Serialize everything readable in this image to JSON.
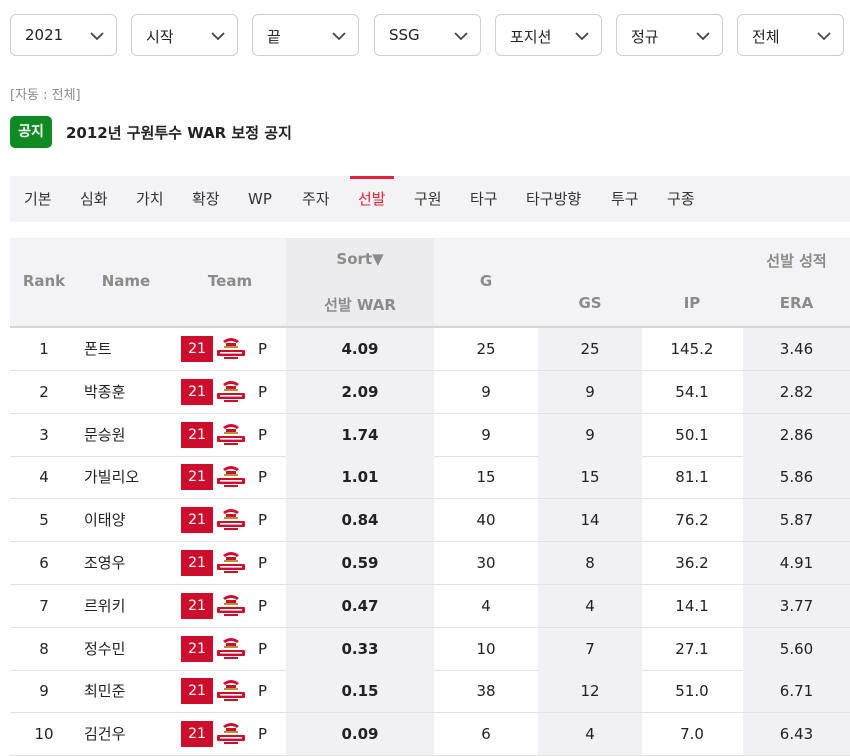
{
  "filters": [
    {
      "label": "2021"
    },
    {
      "label": "시작"
    },
    {
      "label": "끝"
    },
    {
      "label": "SSG"
    },
    {
      "label": "포지션"
    },
    {
      "label": "정규"
    },
    {
      "label": "전체"
    }
  ],
  "auto_note": "[자동 : 전체]",
  "notice": {
    "badge": "공지",
    "text": "2012년 구원투수 WAR 보정 공지"
  },
  "tabs": [
    "기본",
    "심화",
    "가치",
    "확장",
    "WP",
    "주자",
    "선발",
    "구원",
    "타구",
    "타구방향",
    "투구",
    "구종"
  ],
  "active_tab": "선발",
  "table": {
    "headers": {
      "rank": "Rank",
      "name": "Name",
      "team": "Team",
      "sort": "Sort▼",
      "war": "선발 WAR",
      "g": "G",
      "group": "선발 성적",
      "gs": "GS",
      "ip": "IP",
      "era": "ERA"
    },
    "rows": [
      {
        "rank": "1",
        "name": "폰트",
        "team_year": "21",
        "pos": "P",
        "war": "4.09",
        "g": "25",
        "gs": "25",
        "ip": "145.2",
        "era": "3.46"
      },
      {
        "rank": "2",
        "name": "박종훈",
        "team_year": "21",
        "pos": "P",
        "war": "2.09",
        "g": "9",
        "gs": "9",
        "ip": "54.1",
        "era": "2.82"
      },
      {
        "rank": "3",
        "name": "문승원",
        "team_year": "21",
        "pos": "P",
        "war": "1.74",
        "g": "9",
        "gs": "9",
        "ip": "50.1",
        "era": "2.86"
      },
      {
        "rank": "4",
        "name": "가빌리오",
        "team_year": "21",
        "pos": "P",
        "war": "1.01",
        "g": "15",
        "gs": "15",
        "ip": "81.1",
        "era": "5.86"
      },
      {
        "rank": "5",
        "name": "이태양",
        "team_year": "21",
        "pos": "P",
        "war": "0.84",
        "g": "40",
        "gs": "14",
        "ip": "76.2",
        "era": "5.87"
      },
      {
        "rank": "6",
        "name": "조영우",
        "team_year": "21",
        "pos": "P",
        "war": "0.59",
        "g": "30",
        "gs": "8",
        "ip": "36.2",
        "era": "4.91"
      },
      {
        "rank": "7",
        "name": "르위키",
        "team_year": "21",
        "pos": "P",
        "war": "0.47",
        "g": "4",
        "gs": "4",
        "ip": "14.1",
        "era": "3.77"
      },
      {
        "rank": "8",
        "name": "정수민",
        "team_year": "21",
        "pos": "P",
        "war": "0.33",
        "g": "10",
        "gs": "7",
        "ip": "27.1",
        "era": "5.60"
      },
      {
        "rank": "9",
        "name": "최민준",
        "team_year": "21",
        "pos": "P",
        "war": "0.15",
        "g": "38",
        "gs": "12",
        "ip": "51.0",
        "era": "6.71"
      },
      {
        "rank": "10",
        "name": "김건우",
        "team_year": "21",
        "pos": "P",
        "war": "0.09",
        "g": "6",
        "gs": "4",
        "ip": "7.0",
        "era": "6.43"
      }
    ]
  },
  "colors": {
    "accent": "#e8203a",
    "notice_green": "#108a23",
    "team_red": "#ce0e2d"
  },
  "icons": {
    "filter_chevron": "chevron-down-icon",
    "team_logo": "landers-logo-icon"
  }
}
